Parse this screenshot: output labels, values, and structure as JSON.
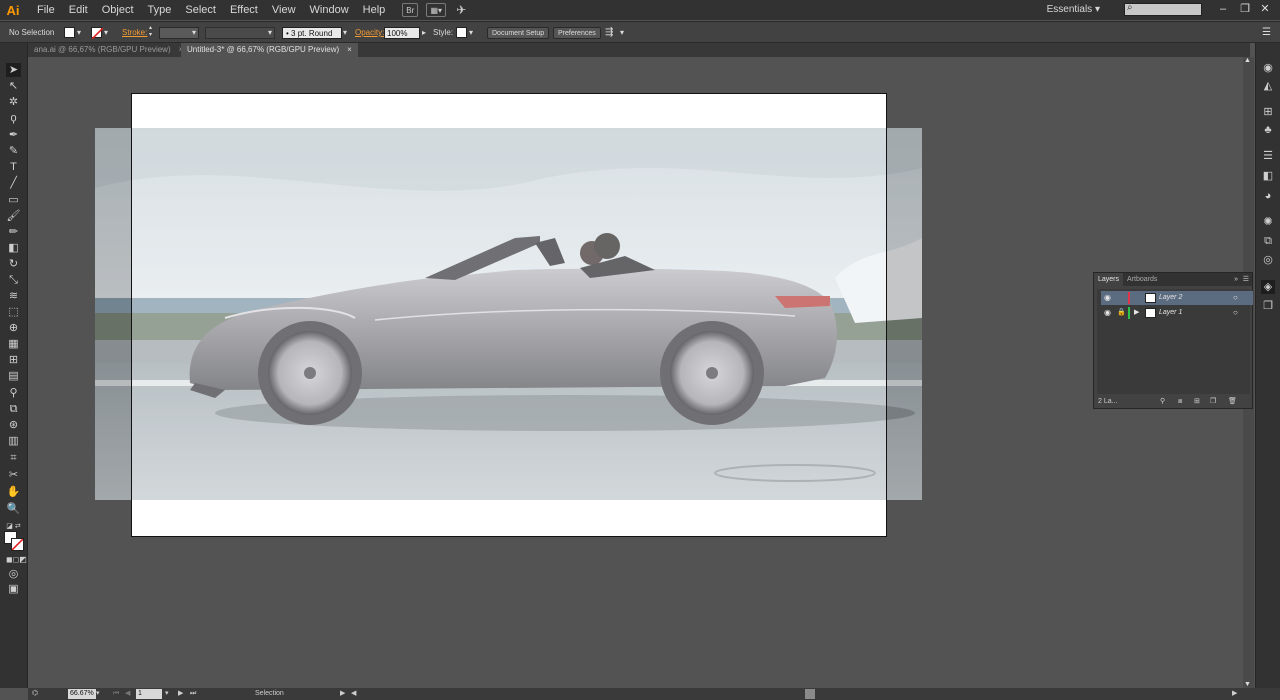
{
  "app": {
    "logo": "Ai"
  },
  "menu": [
    "File",
    "Edit",
    "Object",
    "Type",
    "Select",
    "Effect",
    "View",
    "Window",
    "Help"
  ],
  "menu_icons": {
    "bridge": "Br",
    "arrange": "arrange-documents-icon",
    "gpu": "gpu-performance-icon"
  },
  "workspace": {
    "label": "Essentials"
  },
  "search": {
    "placeholder": ""
  },
  "window_controls": {
    "minimize": "–",
    "restore": "❐",
    "close": "✕"
  },
  "controlbar": {
    "selection_label": "No Selection",
    "stroke_label": "Stroke:",
    "brush_label": "3 pt. Round",
    "opacity_label": "Opacity:",
    "opacity_value": "100%",
    "style_label": "Style:",
    "doc_setup": "Document Setup",
    "preferences": "Preferences"
  },
  "tabs": [
    {
      "label": "ana.ai @ 66,67% (RGB/GPU Preview)",
      "close": "×",
      "active": false
    },
    {
      "label": "Untitled-3* @ 66,67% (RGB/GPU Preview)",
      "close": "×",
      "active": true
    }
  ],
  "status": {
    "zoom": "66.67%",
    "artboard": "1",
    "tool": "Selection"
  },
  "layers_panel": {
    "tabs": [
      "Layers",
      "Artboards"
    ],
    "layers": [
      {
        "name": "Layer 2",
        "color": "#e0354b",
        "selected": true
      },
      {
        "name": "Layer 1",
        "color": "#2ec24a",
        "selected": false
      }
    ],
    "footer": "2 La..."
  },
  "colors": {
    "accent": "#f29b35",
    "canvas": "#535353",
    "ui_dark": "#323232"
  }
}
